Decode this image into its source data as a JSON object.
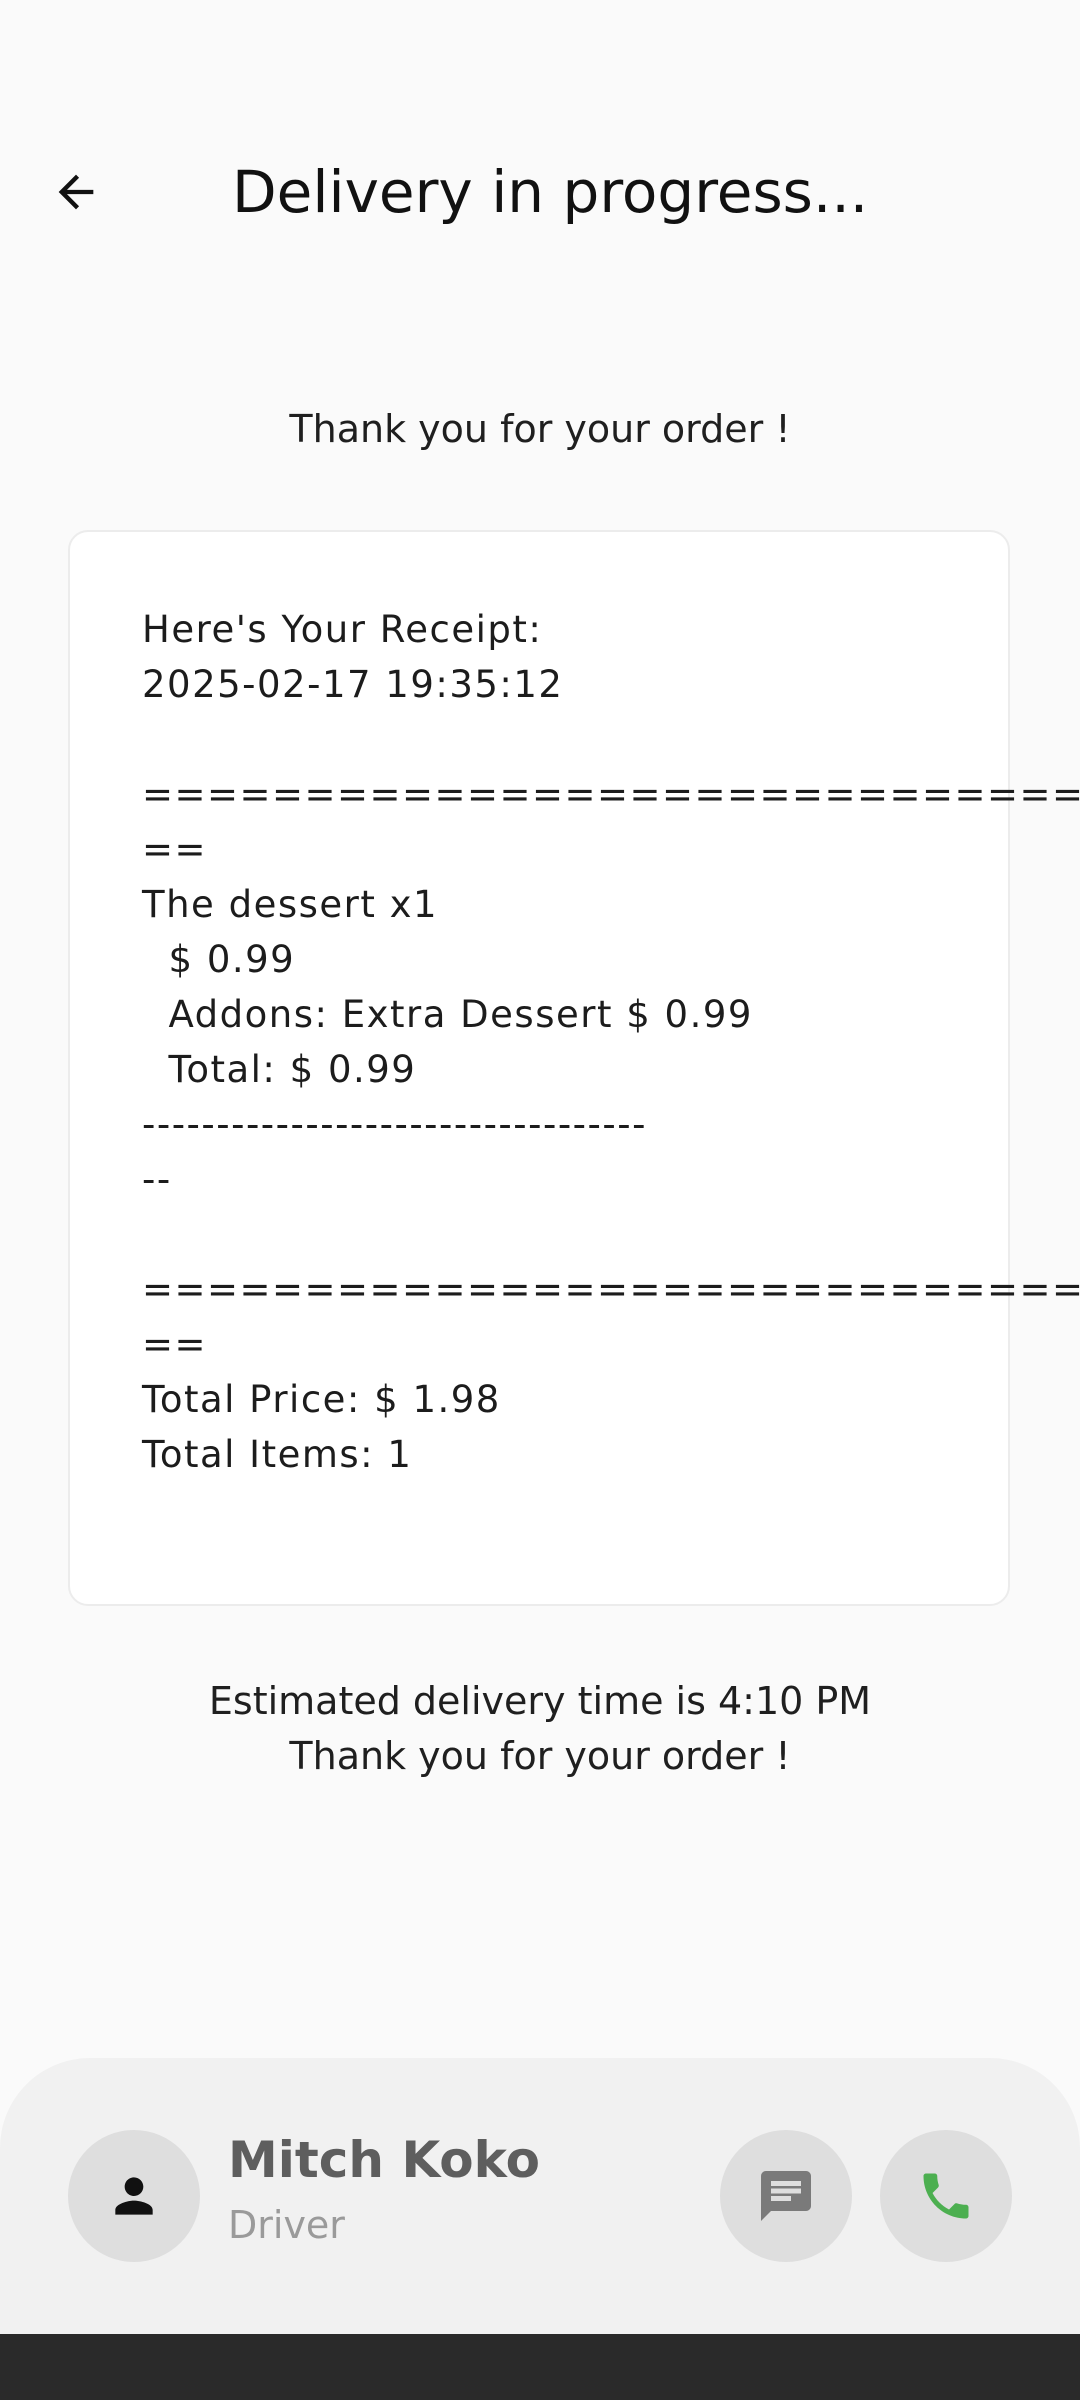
{
  "app_bar": {
    "back_icon": "arrow-left-icon",
    "title": "Delivery in progress..."
  },
  "thanks_heading": "Thank you for your order !",
  "receipt": {
    "text": "Here's Your Receipt:\n2025-02-17 19:35:12\n\n==================================\n==\nThe dessert x1\n  $ 0.99\n  Addons: Extra Dessert $ 0.99\n  Total: $ 0.99\n----------------------------------\n--\n\n==================================\n==\nTotal Price: $ 1.98\nTotal Items: 1"
  },
  "eta": {
    "line1": "Estimated delivery time is 4:10 PM",
    "line2": "Thank you for your order !"
  },
  "driver": {
    "name": "Mitch Koko",
    "role": "Driver",
    "avatar_icon": "person-icon",
    "message_icon": "chat-icon",
    "call_icon": "phone-icon"
  },
  "colors": {
    "background": "#fafafa",
    "card": "#ffffff",
    "panel": "#f1f1f1",
    "button_bg": "#dedede",
    "call_green": "#4caf50",
    "message_grey": "#7a7a7a",
    "nav_bar": "#2a2a2a"
  }
}
